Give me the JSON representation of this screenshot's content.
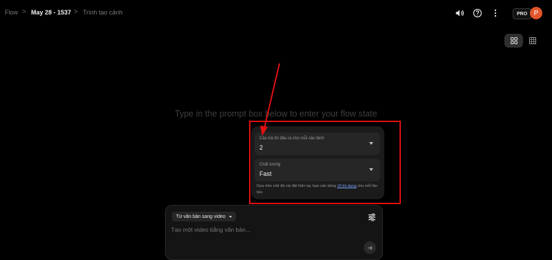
{
  "breadcrumb": {
    "root": "Flow",
    "project": "May 28 - 1537",
    "current": "Trình tạo cảnh",
    "separator": ">"
  },
  "topbar": {
    "icons": [
      "volume-icon",
      "help-icon",
      "more-vert-icon"
    ],
    "pro_badge": "PRO",
    "avatar_initial": "P",
    "avatar_color": "#e2552a"
  },
  "view_toggle": {
    "icons": [
      "grid-large-icon",
      "grid-small-icon"
    ],
    "active": "grid-large-icon"
  },
  "heading": "Type in the prompt box below to enter your flow state",
  "settings": {
    "outputs": {
      "label": "Câu trả lời đầu ra cho mỗi câu lệnh",
      "value": "2"
    },
    "quality": {
      "label": "Chất lượng",
      "value": "Fast"
    },
    "note_prefix": "Dựa trên chế độ cài đặt hiện tại, bạn cần dùng ",
    "note_link": "10 tín dụng",
    "note_suffix": " cho mỗi lần tạo."
  },
  "prompt": {
    "mode": "Từ văn bản sang video",
    "placeholder": "Tạo một video bằng văn bản..."
  },
  "colors": {
    "annotation": "#e01010",
    "accent_link": "#7aa7ff"
  }
}
